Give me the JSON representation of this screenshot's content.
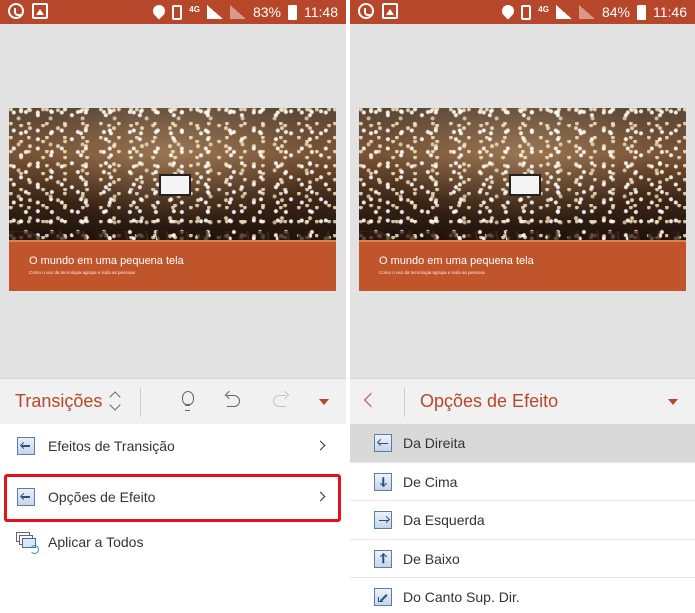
{
  "left_screen": {
    "status_bar": {
      "network_label": "4G",
      "battery": "83%",
      "time": "11:48"
    },
    "slide": {
      "title": "O mundo em uma pequena tela",
      "subtitle": "Como o uso da tecnologia agrupa e isola as pessoas"
    },
    "toolbar": {
      "title": "Transições"
    },
    "menu": [
      {
        "label": "Efeitos de Transição"
      },
      {
        "label": "Opções de Efeito"
      },
      {
        "label": "Aplicar a Todos"
      }
    ]
  },
  "right_screen": {
    "status_bar": {
      "network_label": "4G",
      "battery": "84%",
      "time": "11:46"
    },
    "slide": {
      "title": "O mundo em uma pequena tela",
      "subtitle": "Como o uso da tecnologia agrupa e isola as pessoas"
    },
    "toolbar": {
      "title": "Opções de Efeito"
    },
    "options": [
      {
        "label": "Da Direita",
        "selected": true
      },
      {
        "label": "De Cima"
      },
      {
        "label": "Da Esquerda"
      },
      {
        "label": "De Baixo"
      },
      {
        "label": "Do Canto Sup. Dir."
      }
    ]
  },
  "colors": {
    "accent": "#b7472a",
    "highlight_box": "#e0121a",
    "selected_row": "#d9d9d9"
  }
}
